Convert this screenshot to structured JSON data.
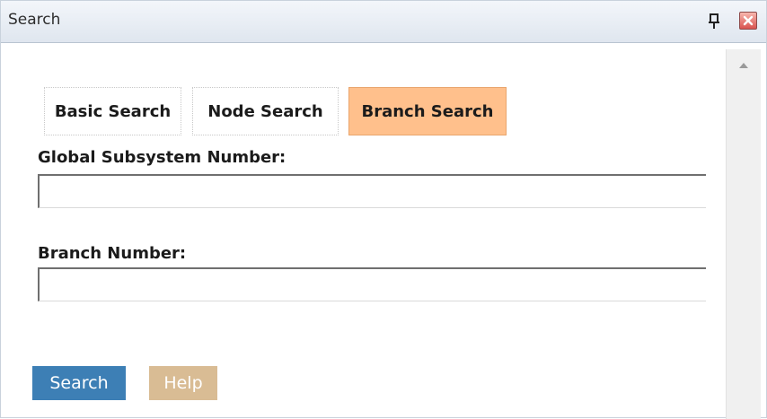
{
  "window": {
    "title": "Search",
    "pin_icon": "pin-icon",
    "close_icon": "close-icon"
  },
  "tabs": [
    {
      "label": "Basic Search",
      "active": false
    },
    {
      "label": "Node Search",
      "active": false
    },
    {
      "label": "Branch Search",
      "active": true
    }
  ],
  "form": {
    "subsystem_label": "Global Subsystem Number:",
    "subsystem_value": "",
    "branch_label": "Branch Number:",
    "branch_value": ""
  },
  "buttons": {
    "search_label": "Search",
    "help_label": "Help"
  },
  "colors": {
    "active_tab": "#ffc08c",
    "search_button": "#3d7fb5",
    "help_button": "#d9bc94",
    "close_button": "#d9534f"
  }
}
